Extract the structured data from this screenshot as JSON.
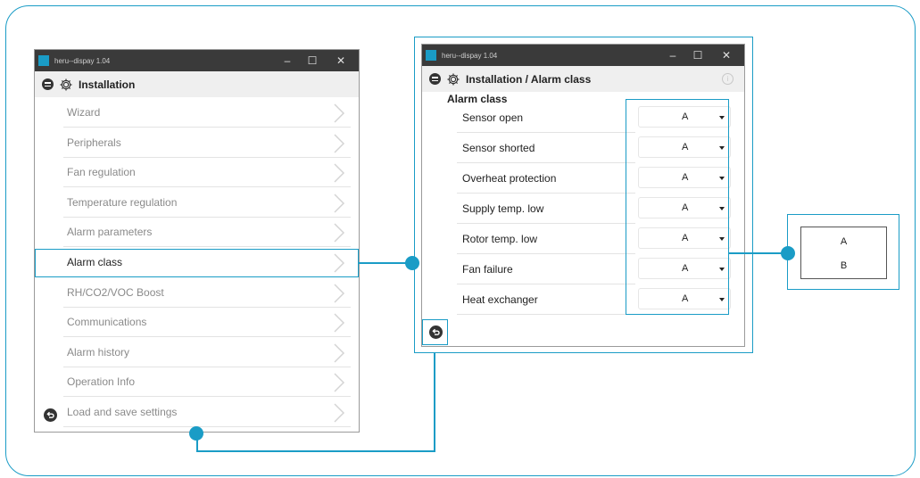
{
  "left_window": {
    "app_title": "heru--dispay 1.04",
    "controls": {
      "minimize": "–",
      "maximize": "☐",
      "close": "✕"
    },
    "header_title": "Installation",
    "items": [
      {
        "label": "Wizard"
      },
      {
        "label": "Peripherals"
      },
      {
        "label": "Fan regulation"
      },
      {
        "label": "Temperature regulation"
      },
      {
        "label": "Alarm parameters"
      },
      {
        "label": "Alarm class",
        "active": true
      },
      {
        "label": "RH/CO2/VOC Boost"
      },
      {
        "label": "Communications"
      },
      {
        "label": "Alarm history"
      },
      {
        "label": "Operation Info"
      },
      {
        "label": "Load and save settings"
      }
    ]
  },
  "right_window": {
    "app_title": "heru--dispay 1.04",
    "controls": {
      "minimize": "–",
      "maximize": "☐",
      "close": "✕"
    },
    "header_title": "Installation / Alarm class",
    "section_title": "Alarm class",
    "rows": [
      {
        "label": "Sensor open",
        "value": "A"
      },
      {
        "label": "Sensor shorted",
        "value": "A"
      },
      {
        "label": "Overheat protection",
        "value": "A"
      },
      {
        "label": "Supply temp. low",
        "value": "A"
      },
      {
        "label": "Rotor temp. low",
        "value": "A"
      },
      {
        "label": "Fan failure",
        "value": "A"
      },
      {
        "label": "Heat exchanger",
        "value": "A"
      }
    ]
  },
  "options_popup": {
    "options": [
      "A",
      "B"
    ]
  },
  "colors": {
    "accent": "#1a9cc6",
    "titlebar": "#3a3a3a",
    "header": "#efefef"
  },
  "icons": [
    "menu-icon",
    "gear-icon",
    "chevron-right-icon",
    "back-icon",
    "info-icon",
    "dropdown-caret-icon",
    "app-icon"
  ]
}
